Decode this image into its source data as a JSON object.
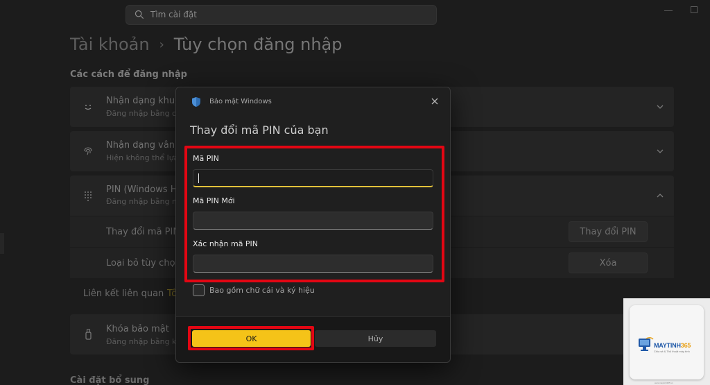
{
  "search": {
    "placeholder": "Tìm cài đặt"
  },
  "breadcrumb": {
    "parent": "Tài khoản",
    "current": "Tùy chọn đăng nhập"
  },
  "section_title": "Các cách để đăng nhập",
  "sign_in_options": [
    {
      "title": "Nhận dạng khuôn",
      "subtitle": "Đăng nhập bằng ca",
      "icon": "face-icon"
    },
    {
      "title": "Nhận dạng vân ta",
      "subtitle": "Hiện không thể lựa",
      "icon": "fingerprint-icon"
    },
    {
      "title": "PIN (Windows He",
      "subtitle": "Đăng nhập bằng m",
      "icon": "pin-keypad-icon"
    }
  ],
  "pin_rows": [
    {
      "label": "Thay đổi mã PIN",
      "button": "Thay đổi PIN"
    },
    {
      "label": "Loại bỏ tùy chọn",
      "button": "Xóa"
    }
  ],
  "related": {
    "label": "Liên kết liên quan",
    "link": "Tô"
  },
  "security_key": {
    "title": "Khóa bảo mật",
    "subtitle": "Đăng nhập bằng kh",
    "icon": "security-key-icon"
  },
  "bottom_section": "Cài đặt bổ sung",
  "dialog": {
    "app_title": "Bảo mật Windows",
    "heading": "Thay đổi mã PIN của bạn",
    "fields": [
      {
        "label": "Mã PIN",
        "value": ""
      },
      {
        "label": "Mã PIN Mới",
        "value": ""
      },
      {
        "label": "Xác nhận mã PIN",
        "value": ""
      }
    ],
    "checkbox_label": "Bao gồm chữ cái và ký hiệu",
    "ok_label": "OK",
    "cancel_label": "Hủy"
  },
  "watermark": {
    "brand_main": "MAYTINH",
    "brand_num": "365",
    "tagline": "Chia sẻ & Thủ thuật máy tính",
    "url": "www.maytinh365.vn"
  },
  "colors": {
    "accent": "#f5c318",
    "highlight": "#e30613",
    "background": "#1c1c1c"
  }
}
